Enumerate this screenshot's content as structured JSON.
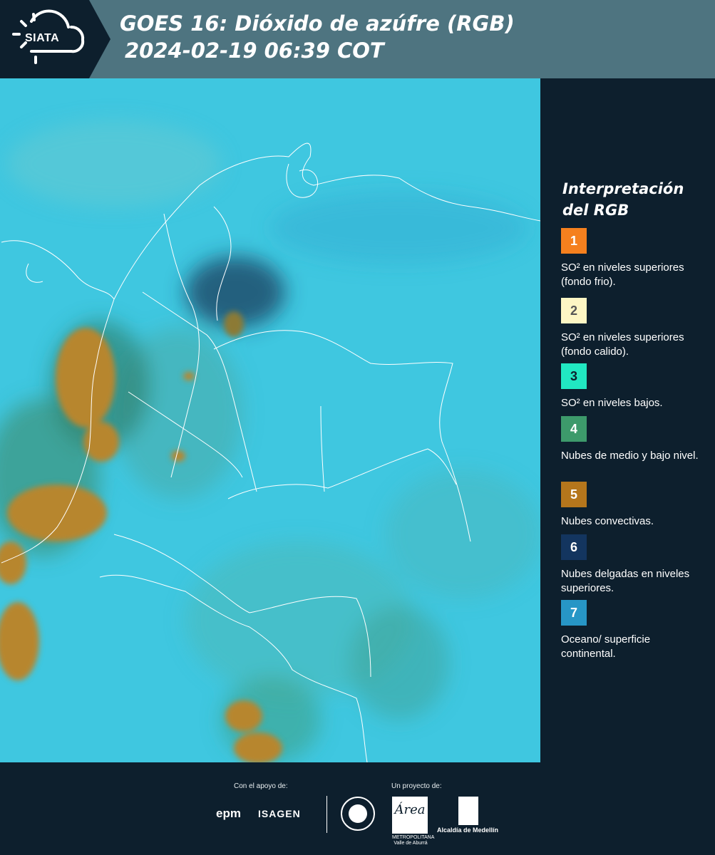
{
  "header": {
    "logo_text": "SIATA",
    "title_line1": "GOES 16: Dióxido de azúfre (RGB)",
    "title_line2": "2024-02-19 06:39 COT"
  },
  "legend": {
    "title": "Interpretación del RGB",
    "items": [
      {
        "number": "1",
        "color": "#f5801e",
        "text": "SO² en niveles superiores (fondo frio)."
      },
      {
        "number": "2",
        "color": "#fdf6c4",
        "text": "SO² en niveles superiores (fondo calido)."
      },
      {
        "number": "3",
        "color": "#21e8c2",
        "text": "SO² en niveles bajos."
      },
      {
        "number": "4",
        "color": "#3d9a6b",
        "text": "Nubes de medio y bajo nivel."
      },
      {
        "number": "5",
        "color": "#b5761c",
        "text": "Nubes convectivas."
      },
      {
        "number": "6",
        "color": "#13355f",
        "text": "Nubes delgadas en niveles superiores."
      },
      {
        "number": "7",
        "color": "#2796c6",
        "text": "Oceano/ superficie continental."
      }
    ]
  },
  "footer": {
    "support_label": "Con el apoyo de:",
    "project_label": "Un proyecto de:",
    "sponsors": [
      "epm",
      "ISAGEN"
    ],
    "area_logo": "Área",
    "area_sub": "METROPOLITANA Valle de Aburrá",
    "alcaldia": "Alcaldía de Medellín"
  },
  "map": {
    "background_color": "#3fc7e0",
    "border_color": "#ffffff"
  }
}
